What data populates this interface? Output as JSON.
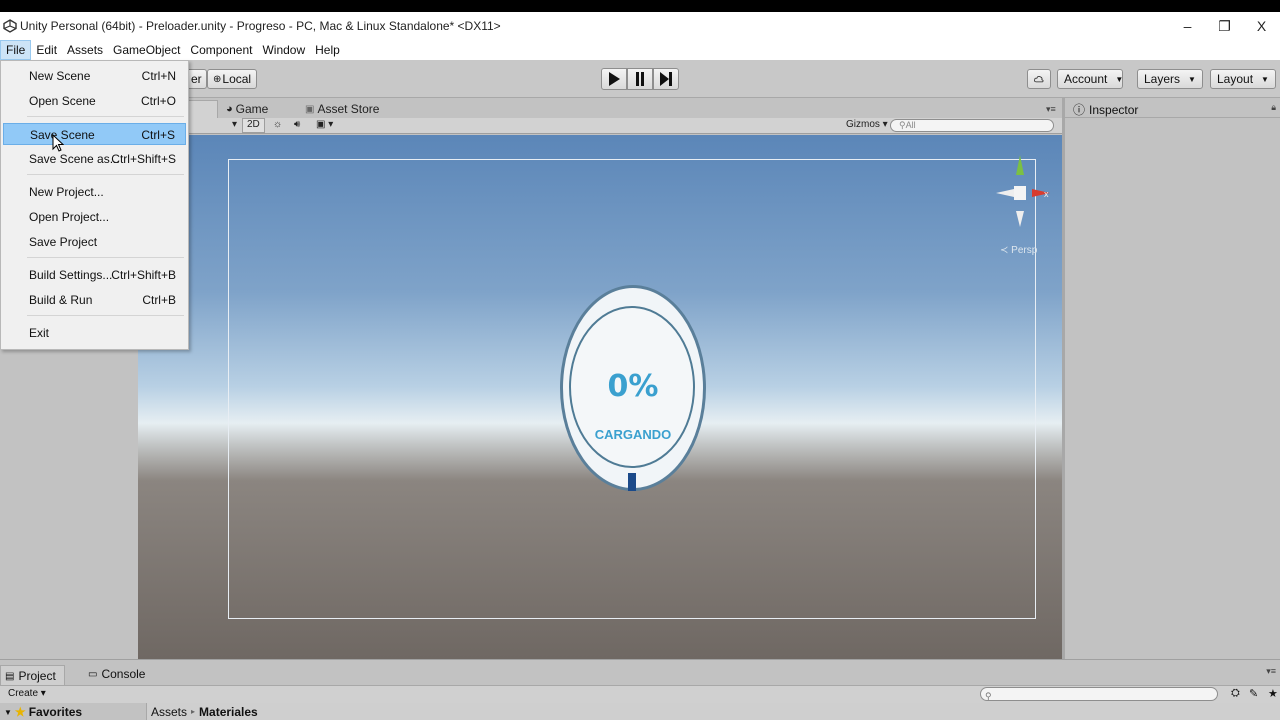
{
  "window": {
    "title": "Unity Personal (64bit) - Preloader.unity - Progreso - PC, Mac & Linux Standalone* <DX11>",
    "controls": [
      "–",
      "❐",
      "X"
    ]
  },
  "menubar": [
    "File",
    "Edit",
    "Assets",
    "GameObject",
    "Component",
    "Window",
    "Help"
  ],
  "toolbar": {
    "pivot_partial": "er",
    "local_label": "Local",
    "account_label": "Account",
    "layers_label": "Layers",
    "layout_label": "Layout"
  },
  "tabs": {
    "game": "Game",
    "asset_store": "Asset Store",
    "inspector": "Inspector"
  },
  "scene_toolbar": {
    "mode_2d": "2D",
    "gizmos_label": "Gizmos",
    "search_placeholder": "All"
  },
  "scene": {
    "percent_text": "0%",
    "loading_text": "CARGANDO",
    "persp_label": "Persp"
  },
  "file_menu": [
    {
      "label": "New Scene",
      "shortcut": "Ctrl+N"
    },
    {
      "label": "Open Scene",
      "shortcut": "Ctrl+O"
    },
    {
      "label": "Save Scene",
      "shortcut": "Ctrl+S",
      "highlighted": true
    },
    {
      "label": "Save Scene as...",
      "shortcut": "Ctrl+Shift+S"
    },
    {
      "label": "New Project...",
      "shortcut": ""
    },
    {
      "label": "Open Project...",
      "shortcut": ""
    },
    {
      "label": "Save Project",
      "shortcut": ""
    },
    {
      "label": "Build Settings...",
      "shortcut": "Ctrl+Shift+B"
    },
    {
      "label": "Build & Run",
      "shortcut": "Ctrl+B"
    },
    {
      "label": "Exit",
      "shortcut": ""
    }
  ],
  "bottom": {
    "project_tab": "Project",
    "console_tab": "Console",
    "create_label": "Create",
    "favorites_label": "Favorites",
    "breadcrumb_root": "Assets",
    "breadcrumb_current": "Materiales"
  },
  "colors": {
    "highlight": "#91c9f7",
    "loader_text": "#3aa0cf",
    "progress_fill": "#1b4a8a"
  }
}
